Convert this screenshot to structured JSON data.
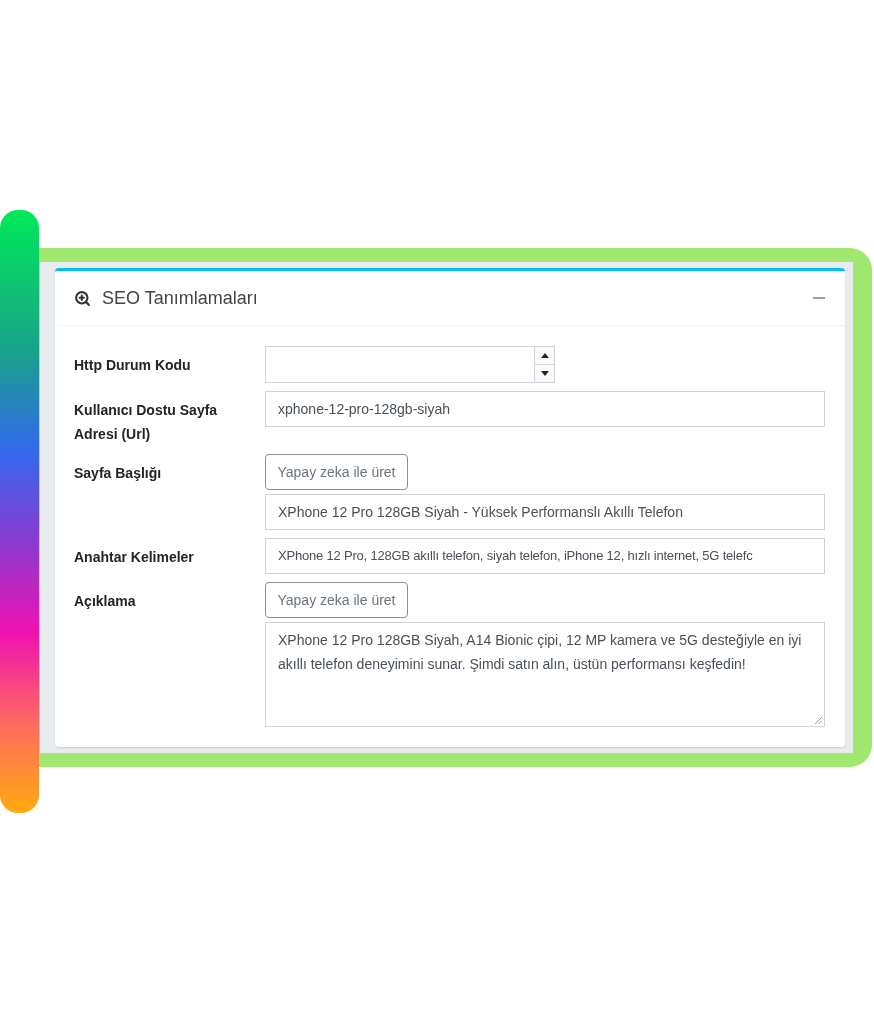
{
  "card": {
    "title": "SEO Tanımlamaları",
    "expanded": true
  },
  "fields": [
    {
      "kind": "number",
      "label": "Http Durum Kodu"
    },
    {
      "kind": "text",
      "label": "Kullanıcı Dostu Sayfa Adresi (Url)",
      "value": "xphone-12-pro-128gb-siyah"
    },
    {
      "kind": "text",
      "label": "Sayfa Başlığı",
      "button": "Yapay zeka ile üret",
      "value": "XPhone 12 Pro 128GB Siyah - Yüksek Performanslı Akıllı Telefon"
    },
    {
      "kind": "text",
      "label": "Anahtar Kelimeler",
      "value": "XPhone 12 Pro, 128GB akıllı telefon, siyah telefon, iPhone 12, hızlı internet, 5G telefc"
    },
    {
      "kind": "textarea",
      "label": "Açıklama",
      "button": "Yapay zeka ile üret",
      "value": "XPhone 12 Pro 128GB Siyah, A14 Bionic çipi, 12 MP kamera ve 5G desteğiyle en iyi akıllı telefon deneyimini sunar. Şimdi satın alın, üstün performansı keşfedin!"
    }
  ]
}
